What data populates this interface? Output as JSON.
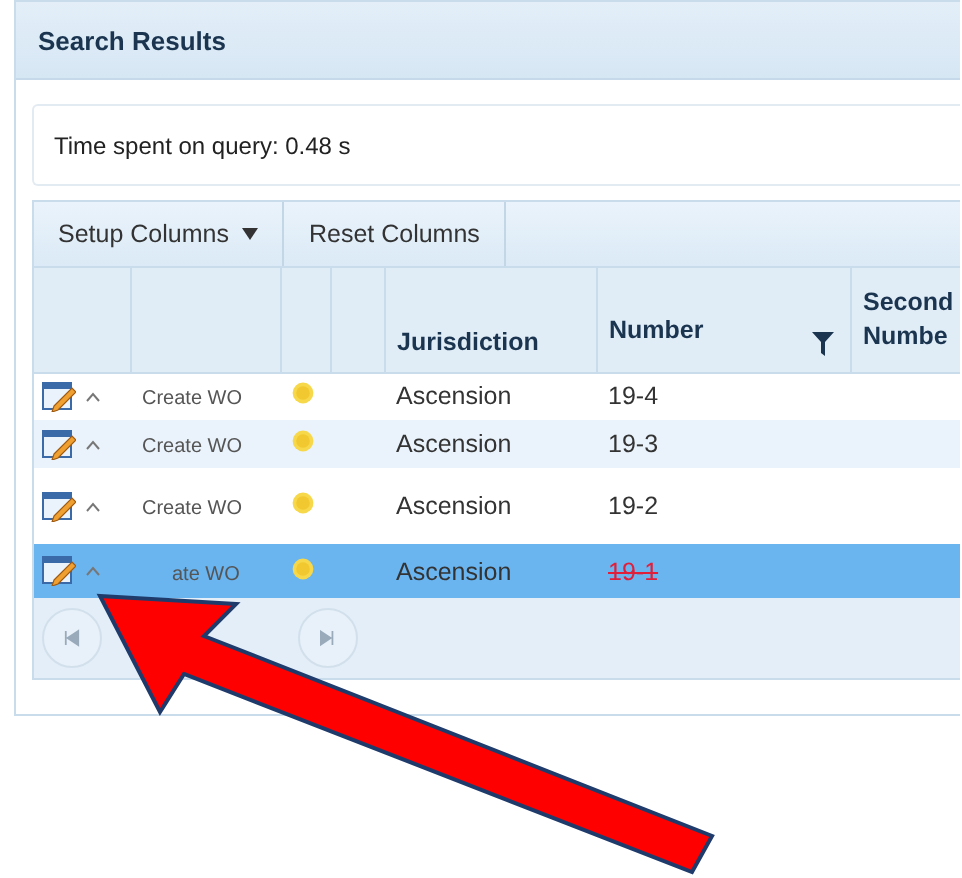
{
  "panel": {
    "title": "Search Results"
  },
  "query_info": "Time spent on query: 0.48 s",
  "toolbar": [
    {
      "label": "Setup Columns",
      "dropdown": true
    },
    {
      "label": "Reset Columns",
      "dropdown": false
    }
  ],
  "table": {
    "columns": [
      {},
      {},
      {},
      {},
      {
        "label": "Jurisdiction",
        "filtered": false
      },
      {
        "label": "Number",
        "filtered": true
      },
      {
        "label": "Second Numbe",
        "filtered": false
      }
    ],
    "rows": [
      {
        "action": "Create WO",
        "jurisdiction": "Ascension",
        "number": "19-4",
        "struck": false,
        "selected": false
      },
      {
        "action": "Create WO",
        "jurisdiction": "Ascension",
        "number": "19-3",
        "struck": false,
        "selected": false
      },
      {
        "action": "Create WO",
        "jurisdiction": "Ascension",
        "number": "19-2",
        "struck": false,
        "selected": false
      },
      {
        "action": "ate WO",
        "jurisdiction": "Ascension",
        "number": "19-1",
        "struck": true,
        "selected": true
      }
    ]
  },
  "pager": {
    "kind": "pager"
  }
}
